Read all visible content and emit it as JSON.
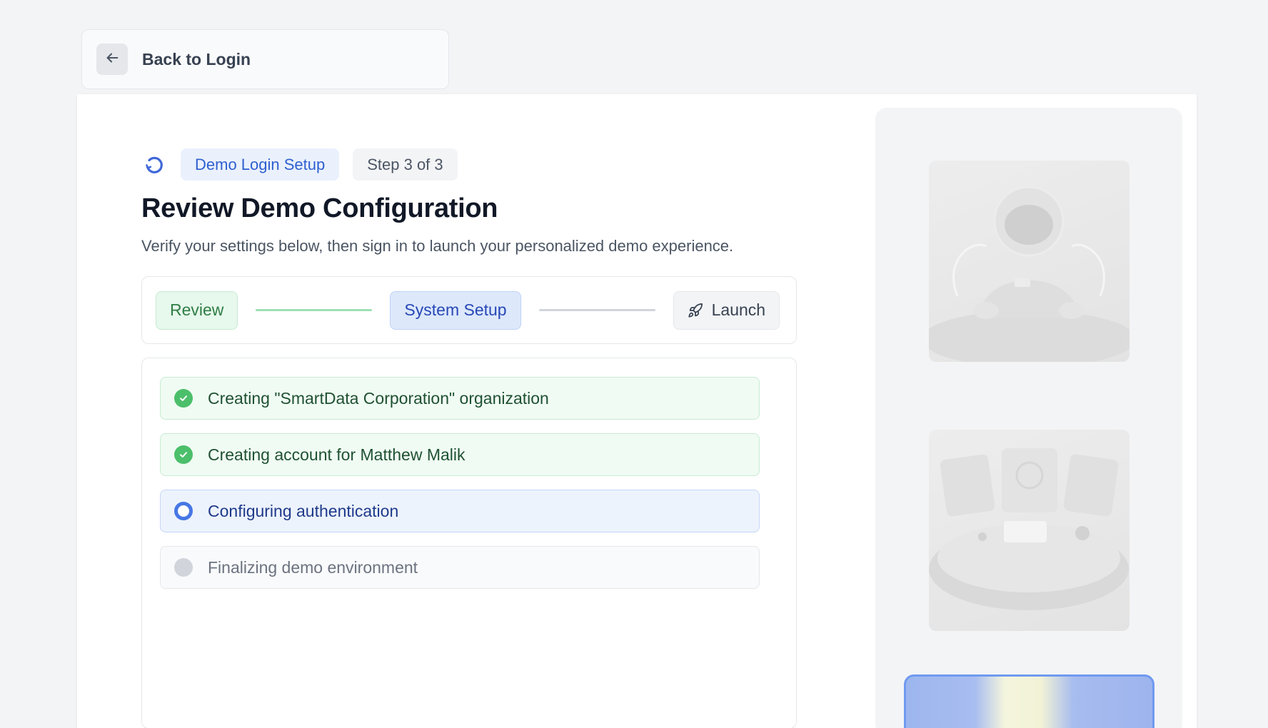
{
  "header": {
    "back_label": "Back to Login"
  },
  "main": {
    "badge_label": "Demo Login Setup",
    "step_counter": "Step 3 of 3",
    "title": "Review Demo Configuration",
    "subtitle": "Verify your settings below, then sign in to launch your personalized demo experience."
  },
  "stepper": {
    "steps": [
      {
        "label": "Review",
        "state": "complete"
      },
      {
        "label": "System Setup",
        "state": "active"
      },
      {
        "label": "Launch",
        "state": "pending",
        "icon": "rocket-icon"
      }
    ]
  },
  "tasks": [
    {
      "label": "Creating \"SmartData Corporation\" organization",
      "state": "done"
    },
    {
      "label": "Creating account for Matthew Malik",
      "state": "done"
    },
    {
      "label": "Configuring authentication",
      "state": "active"
    },
    {
      "label": "Finalizing demo environment",
      "state": "pending"
    }
  ],
  "colors": {
    "accent": "#2f5fd0",
    "success": "#4cbf6b",
    "active": "#4677e4",
    "pending": "#d1d5db"
  },
  "icons": {
    "spinner": "refresh-spinner-icon",
    "back": "arrow-left-icon",
    "launch": "rocket-icon",
    "done": "check-circle-icon"
  }
}
